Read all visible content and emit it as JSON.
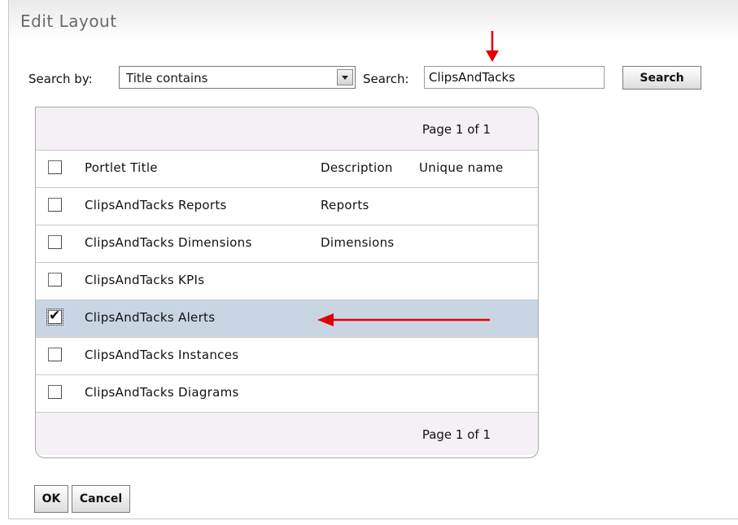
{
  "window": {
    "title": "Edit Layout"
  },
  "search": {
    "by_label": "Search by:",
    "by_selected": "Title contains",
    "search_label": "Search:",
    "query": "ClipsAndTacks",
    "button": "Search"
  },
  "pager": {
    "top": "Page 1 of 1",
    "bottom": "Page 1 of 1"
  },
  "table": {
    "headers": {
      "title": "Portlet Title",
      "description": "Description",
      "unique_name": "Unique name"
    },
    "rows": [
      {
        "title": "ClipsAndTacks Reports",
        "description": "Reports",
        "checked": false
      },
      {
        "title": "ClipsAndTacks Dimensions",
        "description": "Dimensions",
        "checked": false
      },
      {
        "title": "ClipsAndTacks KPIs",
        "description": "",
        "checked": false
      },
      {
        "title": "ClipsAndTacks Alerts",
        "description": "",
        "checked": true
      },
      {
        "title": "ClipsAndTacks Instances",
        "description": "",
        "checked": false
      },
      {
        "title": "ClipsAndTacks Diagrams",
        "description": "",
        "checked": false
      }
    ]
  },
  "actions": {
    "ok": "OK",
    "cancel": "Cancel"
  },
  "colors": {
    "selected_row": "#c9d5e2",
    "pager_bg": "#f5f0f6",
    "annotation_arrow": "#e00000"
  },
  "icons": {
    "checkmark": "✔",
    "dropdown": "chevron-down-icon"
  }
}
